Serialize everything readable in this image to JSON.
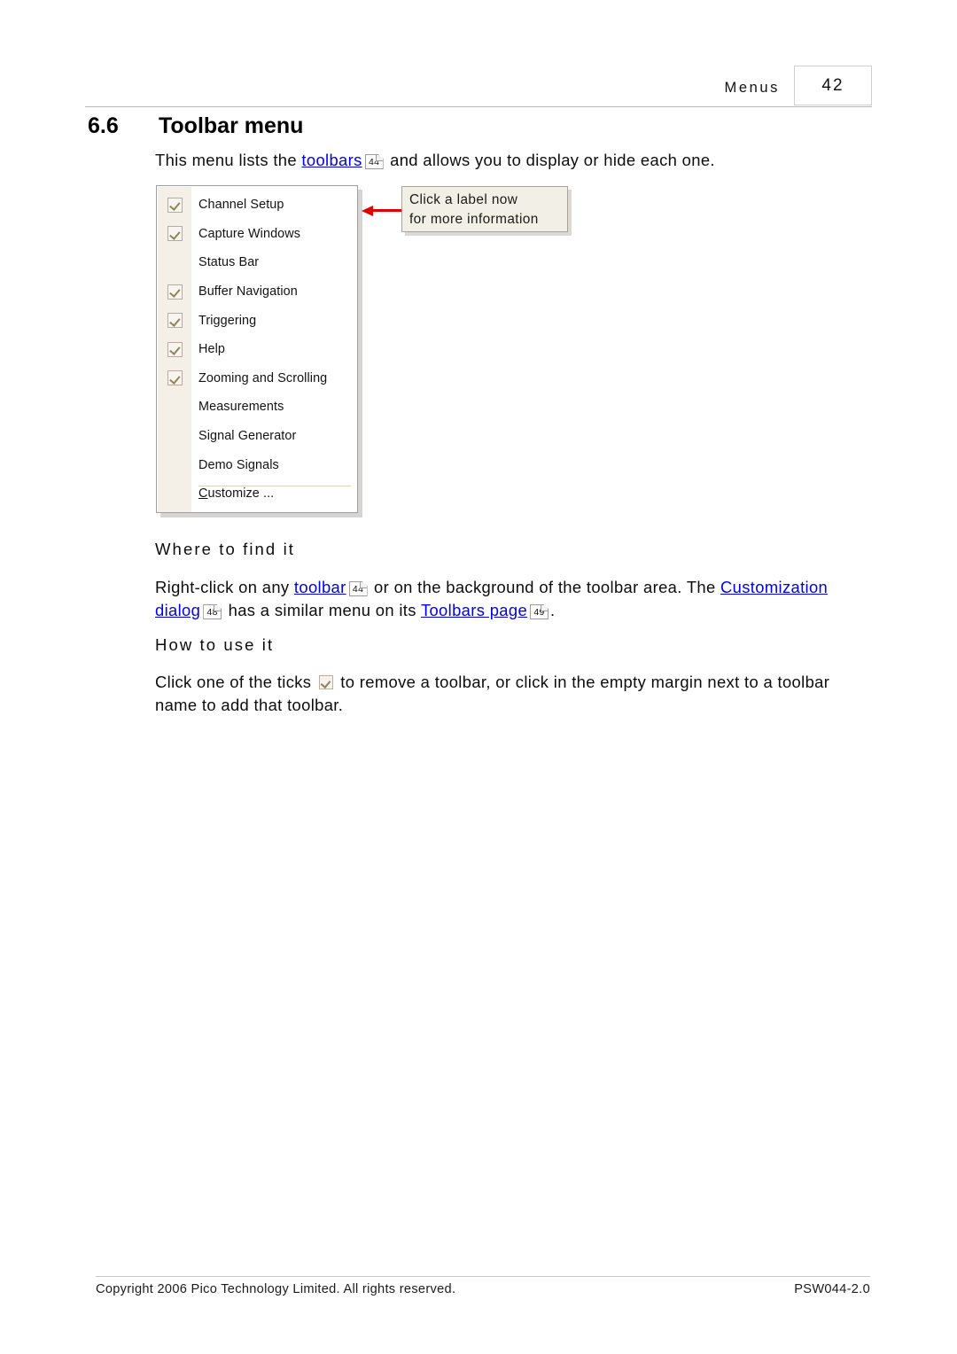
{
  "header": {
    "title": "Menus",
    "page_number": "42"
  },
  "section": {
    "number": "6.6",
    "title": "Toolbar menu"
  },
  "intro": {
    "before_link": "This menu lists the ",
    "link_label": "toolbars",
    "jump_page": "44",
    "after_link": " and allows you to display or hide each one."
  },
  "figure": {
    "menu_items": [
      {
        "label": "Channel Setup",
        "checked": true
      },
      {
        "label": "Capture Windows",
        "checked": true
      },
      {
        "label": "Status Bar",
        "checked": false
      },
      {
        "label": "Buffer Navigation",
        "checked": true
      },
      {
        "label": "Triggering",
        "checked": true
      },
      {
        "label": "Help",
        "checked": true
      },
      {
        "label": "Zooming and Scrolling",
        "checked": true
      },
      {
        "label": "Measurements",
        "checked": false
      },
      {
        "label": "Signal Generator",
        "checked": false
      },
      {
        "label": "Demo Signals",
        "checked": false
      },
      {
        "label": "Customize ...",
        "checked": false,
        "accelerator": "C"
      }
    ],
    "callout": {
      "line1": "Click a label now",
      "line2": "for more information"
    },
    "arrow_color": "#e00000",
    "checkbox_border_color": "#c0a6a2",
    "checkbox_tick_color": "#8d8457",
    "menu_gutter_color": "#f4f0e8",
    "callout_bg_color": "#f1efe6"
  },
  "where_to_find_it": {
    "heading": "Where to find it",
    "part1": "Right-click on any ",
    "link1": "toolbar",
    "jump1": "44",
    "part2": " or on the background of the toolbar area. The ",
    "link2": "Customization dialog",
    "jump2": "48",
    "part3": " has a similar menu on its ",
    "link3": "Toolbars page",
    "jump3": "49",
    "part4": "."
  },
  "how_to_use_it": {
    "heading": "How to use it",
    "part1": "Click one of the ticks ",
    "part2": " to remove a toolbar, or click in the empty margin next to a toolbar name to add that toolbar."
  },
  "footer": {
    "copyright": "Copyright 2006 Pico Technology Limited. All rights reserved.",
    "doc_id": "PSW044-2.0"
  },
  "colors": {
    "link": "#0000ee",
    "rule": "#b9b9b9"
  }
}
